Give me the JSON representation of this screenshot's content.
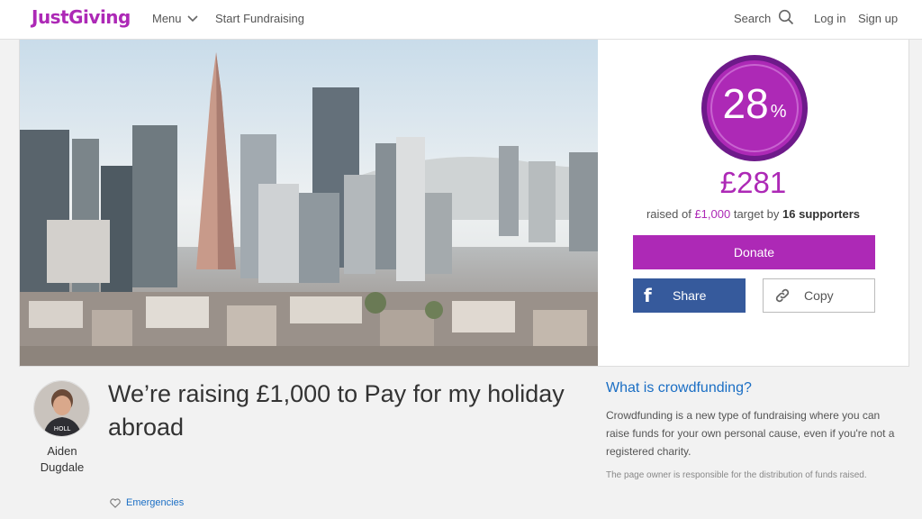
{
  "header": {
    "logo": "JustGiving",
    "menu_label": "Menu",
    "start_label": "Start Fundraising",
    "search_label": "Search",
    "login_label": "Log in",
    "signup_label": "Sign up"
  },
  "progress": {
    "percent_value": "28",
    "percent_sign": "%",
    "raised_amount": "£281",
    "raised_prefix": "raised of ",
    "target": "£1,000",
    "target_mid": " target by ",
    "supporters": "16 supporters"
  },
  "actions": {
    "donate_label": "Donate",
    "share_label": "Share",
    "copy_label": "Copy",
    "facebook_glyph": "f"
  },
  "owner": {
    "name_first": "Aiden",
    "name_last": "Dugdale"
  },
  "page": {
    "title": "We’re raising £1,000 to Pay for my holiday abroad",
    "category": "Emergencies"
  },
  "crowdfunding": {
    "title": "What is crowdfunding?",
    "body": "Crowdfunding is a new type of fundraising where you can raise funds for your own personal cause, even if you're not a registered charity.",
    "note": "The page owner is responsible for the distribution of funds raised."
  },
  "colors": {
    "brand": "#ad29b6",
    "facebook": "#365a9c",
    "link": "#1a6ec4"
  },
  "icons": [
    "chevron-down-icon",
    "search-icon",
    "facebook-icon",
    "link-icon",
    "heart-icon"
  ]
}
